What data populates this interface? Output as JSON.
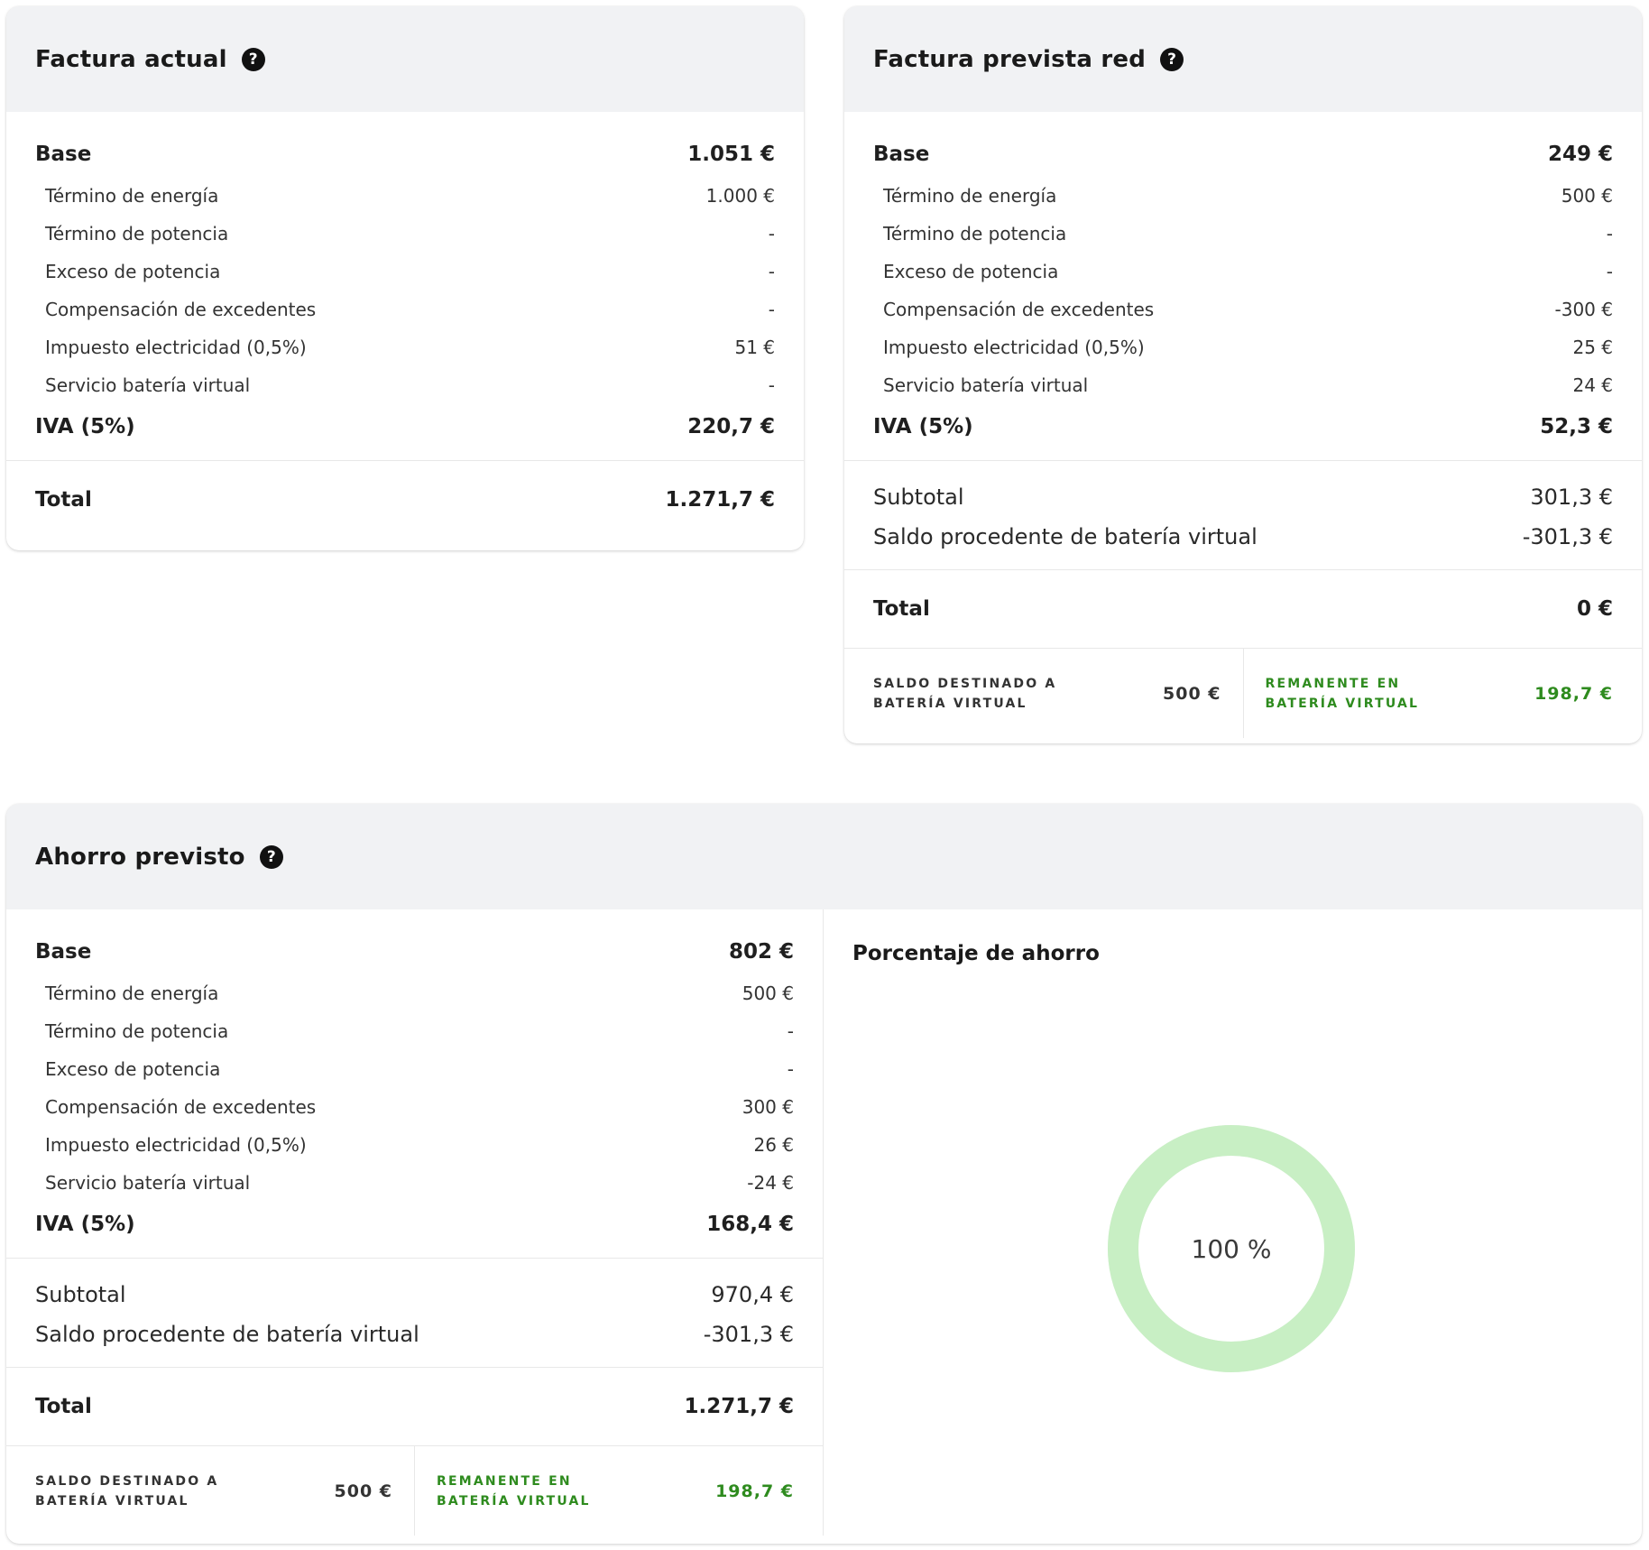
{
  "factura_actual": {
    "title": "Factura actual",
    "base_label": "Base",
    "base_value": "1.051 €",
    "items": [
      {
        "label": "Término de energía",
        "value": "1.000 €"
      },
      {
        "label": "Término de potencia",
        "value": "-"
      },
      {
        "label": "Exceso de potencia",
        "value": "-"
      },
      {
        "label": "Compensación de excedentes",
        "value": "-"
      },
      {
        "label": "Impuesto electricidad (0,5%)",
        "value": "51 €"
      },
      {
        "label": "Servicio batería virtual",
        "value": "-"
      }
    ],
    "iva_label": "IVA (5%)",
    "iva_value": "220,7 €",
    "total_label": "Total",
    "total_value": "1.271,7 €"
  },
  "factura_prevista": {
    "title": "Factura prevista red",
    "base_label": "Base",
    "base_value": "249 €",
    "items": [
      {
        "label": "Término de energía",
        "value": "500 €"
      },
      {
        "label": "Término de potencia",
        "value": "-"
      },
      {
        "label": "Exceso de potencia",
        "value": "-"
      },
      {
        "label": "Compensación de excedentes",
        "value": "-300 €"
      },
      {
        "label": "Impuesto electricidad (0,5%)",
        "value": "25 €"
      },
      {
        "label": "Servicio batería virtual",
        "value": "24 €"
      }
    ],
    "iva_label": "IVA (5%)",
    "iva_value": "52,3 €",
    "subtotal_label": "Subtotal",
    "subtotal_value": "301,3 €",
    "saldo_label": "Saldo procedente de batería virtual",
    "saldo_value": "-301,3 €",
    "total_label": "Total",
    "total_value": "0 €",
    "destinado_label_1": "SALDO DESTINADO A",
    "destinado_label_2": "BATERÍA VIRTUAL",
    "destinado_value": "500 €",
    "remanente_label_1": "REMANENTE EN",
    "remanente_label_2": "BATERÍA VIRTUAL",
    "remanente_value": "198,7 €"
  },
  "ahorro_previsto": {
    "title": "Ahorro previsto",
    "base_label": "Base",
    "base_value": "802 €",
    "items": [
      {
        "label": "Término de energía",
        "value": "500 €"
      },
      {
        "label": "Término de potencia",
        "value": "-"
      },
      {
        "label": "Exceso de potencia",
        "value": "-"
      },
      {
        "label": "Compensación de excedentes",
        "value": "300 €"
      },
      {
        "label": "Impuesto electricidad (0,5%)",
        "value": "26 €"
      },
      {
        "label": "Servicio batería virtual",
        "value": "-24 €"
      }
    ],
    "iva_label": "IVA (5%)",
    "iva_value": "168,4 €",
    "subtotal_label": "Subtotal",
    "subtotal_value": "970,4 €",
    "saldo_label": "Saldo procedente de batería virtual",
    "saldo_value": "-301,3 €",
    "total_label": "Total",
    "total_value": "1.271,7 €",
    "destinado_label_1": "SALDO DESTINADO A",
    "destinado_label_2": "BATERÍA VIRTUAL",
    "destinado_value": "500 €",
    "remanente_label_1": "REMANENTE EN",
    "remanente_label_2": "BATERÍA VIRTUAL",
    "remanente_value": "198,7 €",
    "chart_title": "Porcentaje de ahorro",
    "percent_label": "100 %",
    "percent_value": 100
  },
  "help_glyph": "?",
  "colors": {
    "accent_green": "#2e8b1e",
    "donut_green": "#c8efc4",
    "header_bg": "#f1f2f4"
  }
}
